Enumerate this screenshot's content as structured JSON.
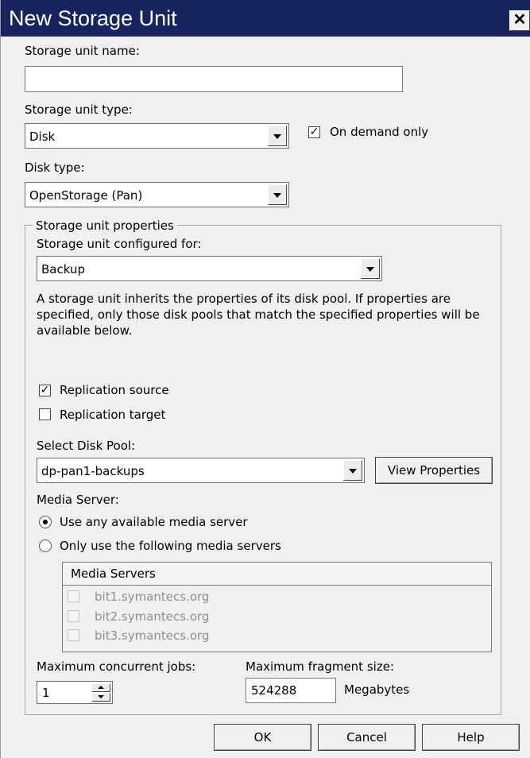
{
  "window": {
    "title": "New Storage Unit",
    "close_glyph": "✕"
  },
  "storage_unit_name": {
    "label": "Storage unit name:",
    "value": ""
  },
  "storage_unit_type": {
    "label": "Storage unit type:",
    "value": "Disk"
  },
  "on_demand_only": {
    "label": "On demand only",
    "checked": true
  },
  "disk_type": {
    "label": "Disk type:",
    "value": "OpenStorage (Pan)"
  },
  "properties": {
    "legend": "Storage unit properties",
    "configured_for_label": "Storage unit configured for:",
    "configured_for_value": "Backup",
    "description": "A storage unit inherits the properties of its disk pool. If properties are specified, only those disk pools that match the specified properties will be available below.",
    "replication_source": {
      "label": "Replication source",
      "checked": true
    },
    "replication_target": {
      "label": "Replication target",
      "checked": false
    },
    "disk_pool_label": "Select Disk Pool:",
    "disk_pool_value": "dp-pan1-backups",
    "view_properties_label": "View Properties",
    "media_server_label": "Media Server:",
    "use_any_label": "Use any available media server",
    "only_use_label": "Only use the following media servers",
    "media_servers_header": "Media Servers",
    "media_servers": [
      {
        "name": "bit1.symantecs.org",
        "checked": false
      },
      {
        "name": "bit2.symantecs.org",
        "checked": false
      },
      {
        "name": "bit3.symantecs.org",
        "checked": false
      }
    ],
    "max_jobs_label": "Maximum concurrent jobs:",
    "max_jobs_value": "1",
    "max_fragment_label": "Maximum fragment size:",
    "max_fragment_value": "524288",
    "max_fragment_unit": "Megabytes"
  },
  "buttons": {
    "ok": "OK",
    "cancel": "Cancel",
    "help": "Help"
  },
  "check_glyph": "✓",
  "colors": {
    "titlebar": "#17245e",
    "dialog_bg": "#f0f0f0",
    "disabled_text": "#8f8f8f"
  }
}
